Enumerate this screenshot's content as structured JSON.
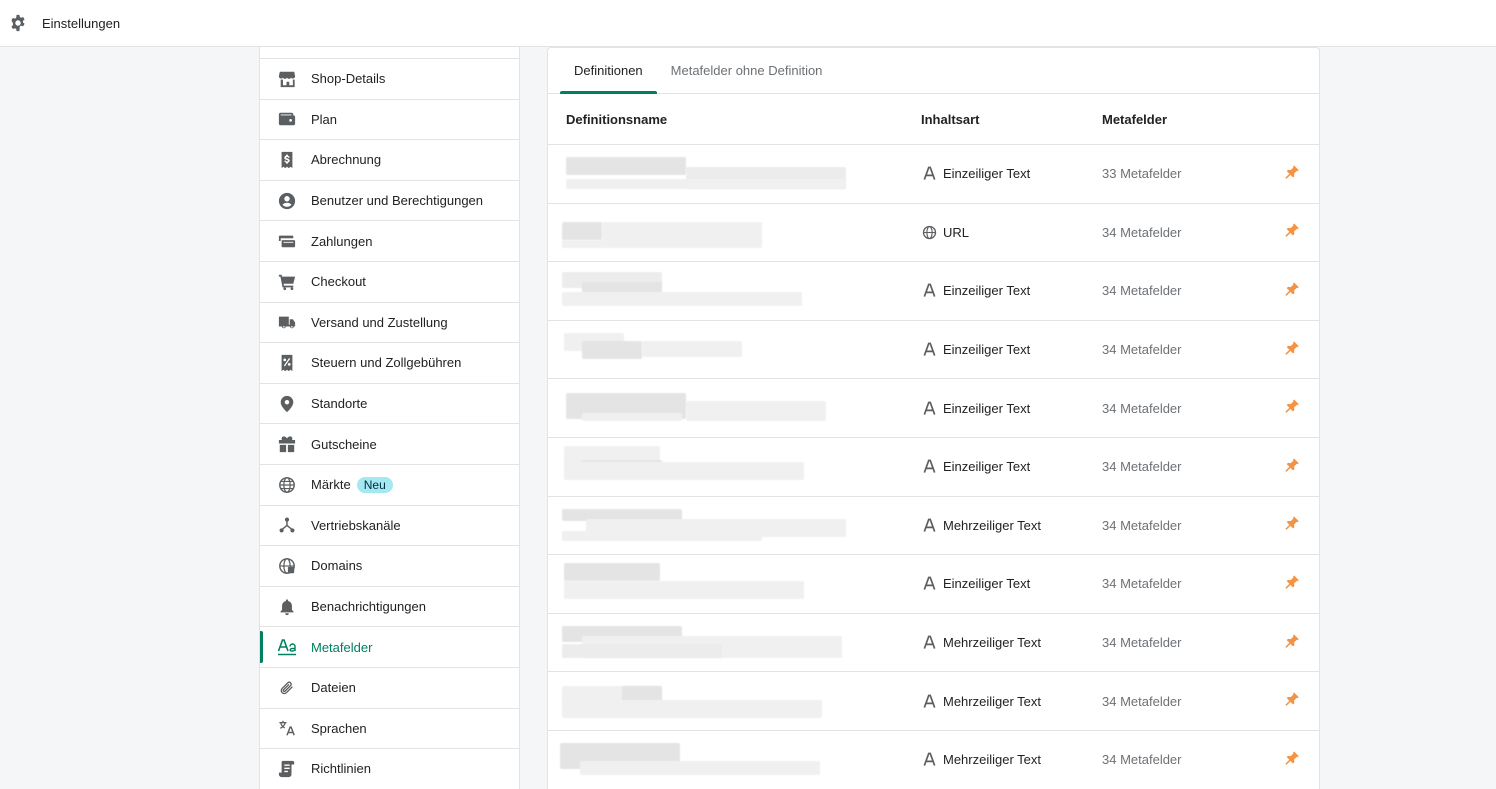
{
  "topbar": {
    "title": "Einstellungen",
    "icon": "gear-icon"
  },
  "sidebar": {
    "items": [
      {
        "label": "Shop-Details",
        "icon": "store-icon"
      },
      {
        "label": "Plan",
        "icon": "wallet-icon"
      },
      {
        "label": "Abrechnung",
        "icon": "receipt-dollar-icon"
      },
      {
        "label": "Benutzer und Berechtigungen",
        "icon": "user-circle-icon"
      },
      {
        "label": "Zahlungen",
        "icon": "payments-icon"
      },
      {
        "label": "Checkout",
        "icon": "cart-icon"
      },
      {
        "label": "Versand und Zustellung",
        "icon": "truck-icon"
      },
      {
        "label": "Steuern und Zollgebühren",
        "icon": "tax-receipt-icon"
      },
      {
        "label": "Standorte",
        "icon": "location-pin-icon"
      },
      {
        "label": "Gutscheine",
        "icon": "gift-icon"
      },
      {
        "label": "Märkte",
        "icon": "globe-icon",
        "badge": "Neu"
      },
      {
        "label": "Vertriebskanäle",
        "icon": "channels-icon"
      },
      {
        "label": "Domains",
        "icon": "domain-globe-icon"
      },
      {
        "label": "Benachrichtigungen",
        "icon": "bell-icon"
      },
      {
        "label": "Metafelder",
        "icon": "metafields-icon",
        "active": true
      },
      {
        "label": "Dateien",
        "icon": "paperclip-icon"
      },
      {
        "label": "Sprachen",
        "icon": "translate-icon"
      },
      {
        "label": "Richtlinien",
        "icon": "policy-scroll-icon"
      }
    ]
  },
  "tabs": [
    {
      "label": "Definitionen",
      "active": true
    },
    {
      "label": "Metafelder ohne Definition"
    }
  ],
  "table": {
    "headers": {
      "name": "Definitionsname",
      "type": "Inhaltsart",
      "count": "Metafelder"
    },
    "rows": [
      {
        "type": "Einzeiliger Text",
        "type_icon": "text-a-icon",
        "count": "33 Metafelder"
      },
      {
        "type": "URL",
        "type_icon": "globe-icon",
        "count": "34 Metafelder"
      },
      {
        "type": "Einzeiliger Text",
        "type_icon": "text-a-icon",
        "count": "34 Metafelder"
      },
      {
        "type": "Einzeiliger Text",
        "type_icon": "text-a-icon",
        "count": "34 Metafelder"
      },
      {
        "type": "Einzeiliger Text",
        "type_icon": "text-a-icon",
        "count": "34 Metafelder"
      },
      {
        "type": "Einzeiliger Text",
        "type_icon": "text-a-icon",
        "count": "34 Metafelder"
      },
      {
        "type": "Mehrzeiliger Text",
        "type_icon": "text-a-icon",
        "count": "34 Metafelder"
      },
      {
        "type": "Einzeiliger Text",
        "type_icon": "text-a-icon",
        "count": "34 Metafelder"
      },
      {
        "type": "Mehrzeiliger Text",
        "type_icon": "text-a-icon",
        "count": "34 Metafelder"
      },
      {
        "type": "Mehrzeiliger Text",
        "type_icon": "text-a-icon",
        "count": "34 Metafelder"
      },
      {
        "type": "Mehrzeiliger Text",
        "type_icon": "text-a-icon",
        "count": "34 Metafelder"
      }
    ]
  },
  "colors": {
    "accent": "#008060",
    "pin": "#f49342",
    "badge_bg": "#a4e8f2"
  }
}
